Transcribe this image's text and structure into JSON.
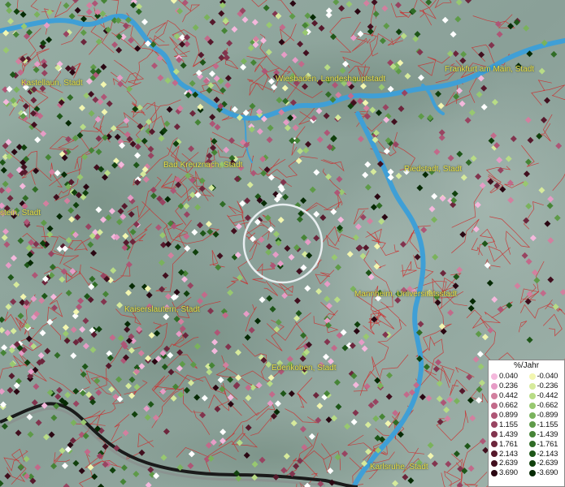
{
  "map": {
    "cities": [
      {
        "name": "Kastellaun, Stadt"
      },
      {
        "name": "Wiesbaden, Landeshauptstadt"
      },
      {
        "name": "Frankfurt am Main, Stadt"
      },
      {
        "name": "Bad Kreuznach, Stadt"
      },
      {
        "name": "Riedstadt, Stadt"
      },
      {
        "name": "stein, Stadt"
      },
      {
        "name": "Mannheim, Universitätsstadt"
      },
      {
        "name": "Kaiserslautern, Stadt"
      },
      {
        "name": "Edenkoben, Stadt"
      },
      {
        "name": "Karlsruhe, Stadt"
      }
    ],
    "colors": {
      "terrain": "#8aa39a",
      "river": "#3f9fd6",
      "boundaries": "#cc2b2b",
      "label_text": "#e8e04a"
    }
  },
  "legend": {
    "title": "%/Jahr",
    "positive": [
      {
        "value": "0.040",
        "color": "#f4b8dc"
      },
      {
        "value": "0.236",
        "color": "#e69cc6"
      },
      {
        "value": "0.442",
        "color": "#d2809f"
      },
      {
        "value": "0.662",
        "color": "#c26a8a"
      },
      {
        "value": "0.899",
        "color": "#ae5676"
      },
      {
        "value": "1.155",
        "color": "#984461"
      },
      {
        "value": "1.439",
        "color": "#82344e"
      },
      {
        "value": "1.761",
        "color": "#6c263c"
      },
      {
        "value": "2.143",
        "color": "#56192c"
      },
      {
        "value": "2.639",
        "color": "#410f1e"
      },
      {
        "value": "3.690",
        "color": "#2a0712"
      }
    ],
    "negative": [
      {
        "value": "-0.040",
        "color": "#f2f6b0"
      },
      {
        "value": "-0.236",
        "color": "#d6ea9c"
      },
      {
        "value": "-0.442",
        "color": "#b8dc86"
      },
      {
        "value": "-0.662",
        "color": "#98c870"
      },
      {
        "value": "-0.899",
        "color": "#7ab25c"
      },
      {
        "value": "-1.155",
        "color": "#5e9a48"
      },
      {
        "value": "-1.439",
        "color": "#468436"
      },
      {
        "value": "-1.761",
        "color": "#306c26"
      },
      {
        "value": "-2.143",
        "color": "#1e5618"
      },
      {
        "value": "-2.639",
        "color": "#10400c"
      },
      {
        "value": "-3.690",
        "color": "#062a04"
      }
    ]
  }
}
